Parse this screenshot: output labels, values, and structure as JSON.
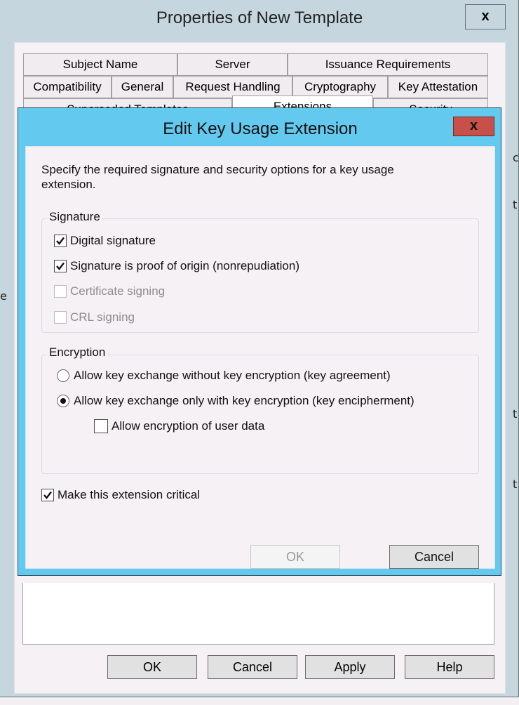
{
  "outer_window": {
    "title": "Properties of New Template",
    "close_label": "x",
    "tabs_row1": [
      {
        "label": "Subject Name"
      },
      {
        "label": "Server"
      },
      {
        "label": "Issuance Requirements"
      }
    ],
    "tabs_row2": [
      {
        "label": "Compatibility"
      },
      {
        "label": "General"
      },
      {
        "label": "Request Handling"
      },
      {
        "label": "Cryptography"
      },
      {
        "label": "Key Attestation"
      }
    ],
    "tabs_row3": [
      {
        "label": "Superseded Templates"
      },
      {
        "label": "Extensions",
        "active": true
      },
      {
        "label": "Security"
      }
    ],
    "buttons": {
      "ok": "OK",
      "cancel": "Cancel",
      "apply": "Apply",
      "help": "Help"
    },
    "clipped_text": {
      "right": [
        "c",
        "t",
        "t",
        "t"
      ],
      "left": [
        "e"
      ]
    }
  },
  "dialog": {
    "title": "Edit Key Usage Extension",
    "close_label": "x",
    "description": "Specify the required signature and security options for a key usage extension.",
    "signature_group": {
      "label": "Signature",
      "options": [
        {
          "label": "Digital signature",
          "checked": true,
          "enabled": true
        },
        {
          "label": "Signature is proof of origin (nonrepudiation)",
          "checked": true,
          "enabled": true
        },
        {
          "label": "Certificate signing",
          "checked": false,
          "enabled": false
        },
        {
          "label": "CRL signing",
          "checked": false,
          "enabled": false
        }
      ]
    },
    "encryption_group": {
      "label": "Encryption",
      "radios": [
        {
          "label": "Allow key exchange without key encryption (key agreement)",
          "selected": false
        },
        {
          "label": "Allow key exchange only with key encryption (key encipherment)",
          "selected": true
        }
      ],
      "suboption": {
        "label": "Allow encryption of user data",
        "checked": false,
        "enabled": true
      }
    },
    "critical": {
      "label": "Make this extension critical",
      "checked": true
    },
    "buttons": {
      "ok": "OK",
      "ok_enabled": false,
      "cancel": "Cancel"
    }
  },
  "colors": {
    "dialog_frame": "#63c9ee",
    "close_button": "#c7504a",
    "outer_frame": "#c6d6de",
    "content_bg": "#f5f1f5"
  }
}
